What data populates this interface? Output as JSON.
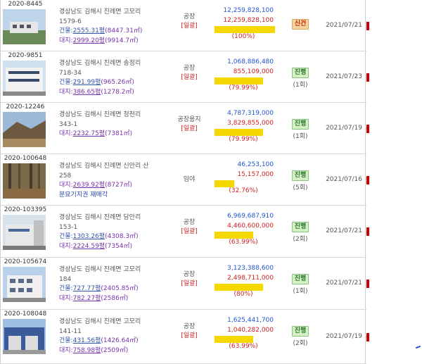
{
  "rows": [
    {
      "case_no": "2020-8445",
      "addr": [
        "경상남도 김해시 진례면 고모리",
        "1579-6"
      ],
      "building": {
        "label": "건물:",
        "pyeong": "2555.31평",
        "sqm": "(8447.31㎡)"
      },
      "land": {
        "label": "대지:",
        "pyeong": "2999.20평",
        "sqm": "(9914.7㎡)"
      },
      "note": "",
      "type": "공장",
      "sub": "[일괄]",
      "appraisal": "12,259,828,100",
      "minimum": "12,259,828,100",
      "ratio": "(100%)",
      "ratio_value": 100,
      "status": "신건",
      "status_kind": "new",
      "round": "",
      "date": "2021/07/21"
    },
    {
      "case_no": "2020-9851",
      "addr": [
        "경상남도 김해시 진례면 송정리",
        "718-34"
      ],
      "building": {
        "label": "건물:",
        "pyeong": "291.99평",
        "sqm": "(965.26㎡)"
      },
      "land": {
        "label": "대지:",
        "pyeong": "386.65평",
        "sqm": "(1278.2㎡)"
      },
      "note": "",
      "type": "공장",
      "sub": "[일괄]",
      "appraisal": "1,068,886,480",
      "minimum": "855,109,000",
      "ratio": "(79.99%)",
      "ratio_value": 79.99,
      "status": "진행",
      "status_kind": "prog",
      "round": "(1회)",
      "date": "2021/07/23"
    },
    {
      "case_no": "2020-12246",
      "addr": [
        "경상남도 김해시 진례면 청천리",
        "343-1"
      ],
      "building": null,
      "land": {
        "label": "대지:",
        "pyeong": "2232.75평",
        "sqm": "(7381㎡)"
      },
      "note": "",
      "type": "공장용지",
      "sub": "[일괄]",
      "appraisal": "4,787,319,000",
      "minimum": "3,829,855,000",
      "ratio": "(79.99%)",
      "ratio_value": 79.99,
      "status": "진행",
      "status_kind": "prog",
      "round": "(1회)",
      "date": "2021/07/19"
    },
    {
      "case_no": "2020-100648",
      "addr": [
        "경상남도 김해시 진례면 신안리 산",
        "258"
      ],
      "building": null,
      "land": {
        "label": "대지:",
        "pyeong": "2639.92평",
        "sqm": "(8727㎡)"
      },
      "note": "분묘기지권 재매각",
      "type": "임야",
      "sub": "",
      "appraisal": "46,253,100",
      "minimum": "15,157,000",
      "ratio": "(32.76%)",
      "ratio_value": 32.76,
      "status": "진행",
      "status_kind": "prog",
      "round": "(5회)",
      "date": "2021/07/16"
    },
    {
      "case_no": "2020-103395",
      "addr": [
        "경상남도 김해시 진례면 담안리",
        "153-1"
      ],
      "building": {
        "label": "건물:",
        "pyeong": "1303.26평",
        "sqm": "(4308.3㎡)"
      },
      "land": {
        "label": "대지:",
        "pyeong": "2224.59평",
        "sqm": "(7354㎡)"
      },
      "note": "",
      "type": "공장",
      "sub": "[일괄]",
      "appraisal": "6,969,687,910",
      "minimum": "4,460,600,000",
      "ratio": "(63.99%)",
      "ratio_value": 63.99,
      "status": "진행",
      "status_kind": "prog",
      "round": "(2회)",
      "date": "2021/07/21"
    },
    {
      "case_no": "2020-105674",
      "addr": [
        "경상남도 김해시 진례면 고모리",
        "184"
      ],
      "building": {
        "label": "건물:",
        "pyeong": "727.77평",
        "sqm": "(2405.85㎡)"
      },
      "land": {
        "label": "대지:",
        "pyeong": "782.27평",
        "sqm": "(2586㎡)"
      },
      "note": "",
      "type": "공장",
      "sub": "[일괄]",
      "appraisal": "3,123,388,600",
      "minimum": "2,498,711,000",
      "ratio": "(80%)",
      "ratio_value": 80,
      "status": "진행",
      "status_kind": "prog",
      "round": "(1회)",
      "date": "2021/07/21"
    },
    {
      "case_no": "2020-108048",
      "addr": [
        "경상남도 김해시 진례면 고모리",
        "141-11"
      ],
      "building": {
        "label": "건물:",
        "pyeong": "431.56평",
        "sqm": "(1426.64㎡)"
      },
      "land": {
        "label": "대지:",
        "pyeong": "758.98평",
        "sqm": "(2509㎡)"
      },
      "note": "",
      "type": "공장",
      "sub": "[일괄]",
      "appraisal": "1,625,441,700",
      "minimum": "1,040,282,000",
      "ratio": "(63.99%)",
      "ratio_value": 63.99,
      "status": "진행",
      "status_kind": "prog",
      "round": "(2회)",
      "date": "2021/07/19"
    }
  ],
  "colors": {
    "appraisal": "#2255cc",
    "minimum": "#cc2222",
    "ratio_bar": "#f5d800",
    "badge_new": "#cc2200",
    "badge_progress": "#2a7a2a"
  }
}
